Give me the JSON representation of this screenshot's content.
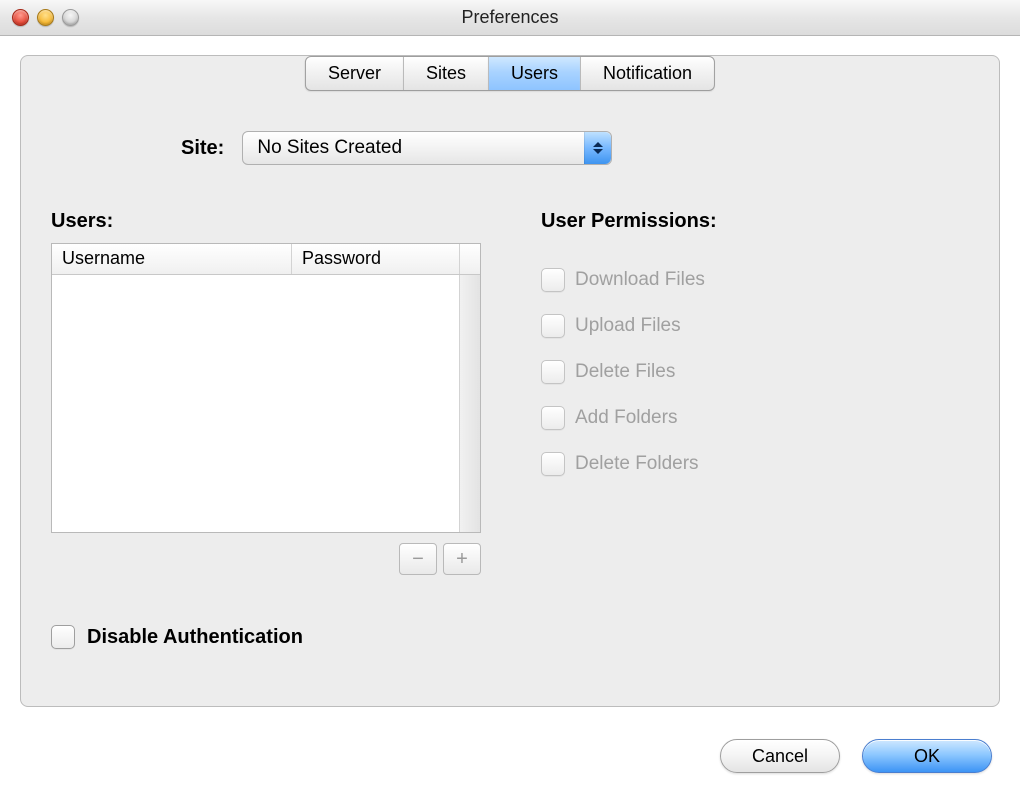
{
  "window": {
    "title": "Preferences"
  },
  "tabs": {
    "items": [
      "Server",
      "Sites",
      "Users",
      "Notification"
    ],
    "selected_index": 2
  },
  "site": {
    "label": "Site:",
    "selected": "No Sites Created"
  },
  "users_section": {
    "heading": "Users:",
    "columns": {
      "username": "Username",
      "password": "Password"
    },
    "rows": [],
    "remove_label": "−",
    "add_label": "+"
  },
  "permissions_section": {
    "heading": "User Permissions:",
    "items": [
      {
        "label": "Download Files",
        "checked": false,
        "enabled": false
      },
      {
        "label": "Upload Files",
        "checked": false,
        "enabled": false
      },
      {
        "label": "Delete Files",
        "checked": false,
        "enabled": false
      },
      {
        "label": "Add Folders",
        "checked": false,
        "enabled": false
      },
      {
        "label": "Delete Folders",
        "checked": false,
        "enabled": false
      }
    ]
  },
  "disable_auth": {
    "label": "Disable Authentication",
    "checked": false
  },
  "footer": {
    "cancel": "Cancel",
    "ok": "OK"
  }
}
